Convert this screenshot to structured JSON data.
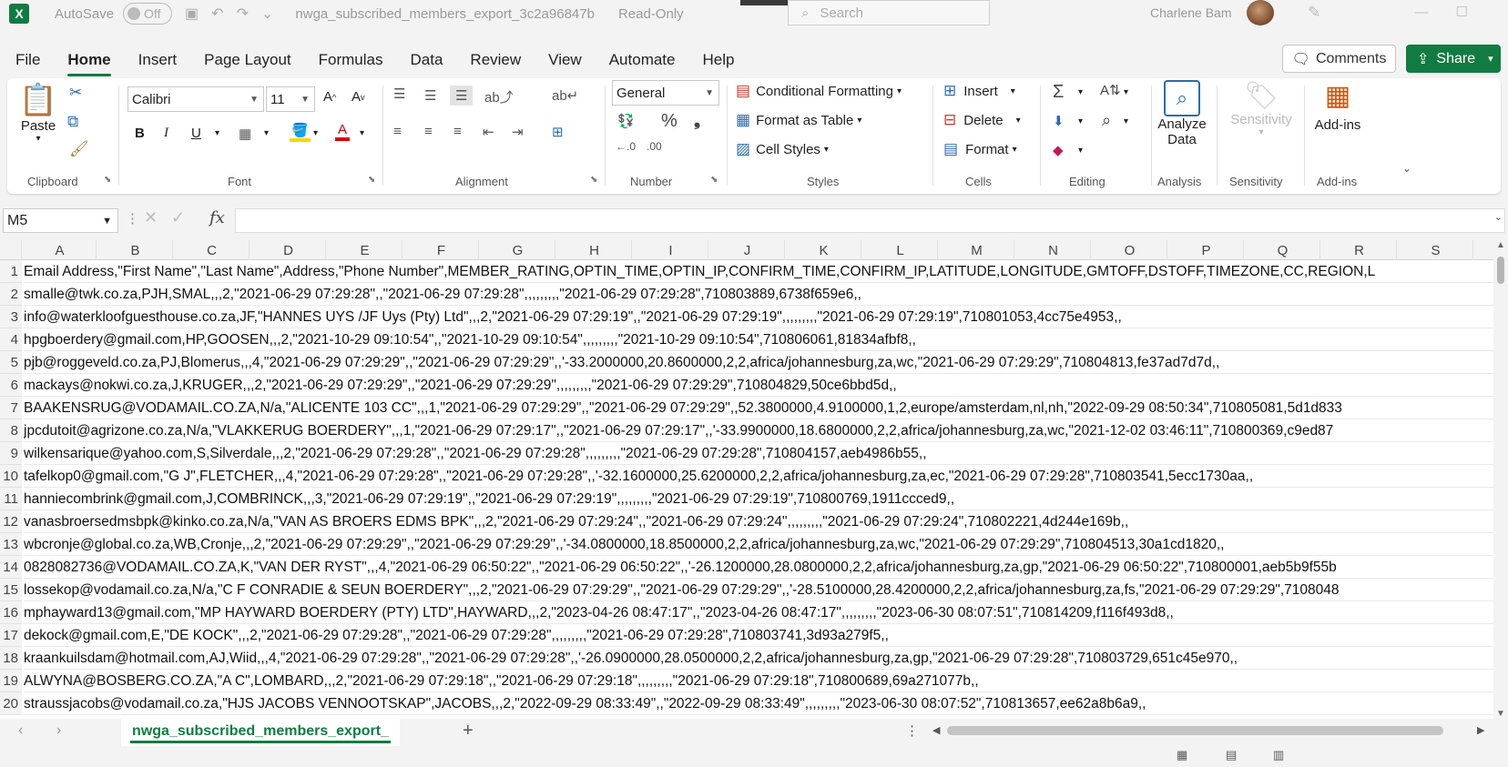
{
  "titlebar": {
    "logo": "X",
    "autosave_label": "AutoSave",
    "autosave_state": "Off",
    "filename": "nwga_subscribed_members_export_3c2a96847b",
    "readonly": "Read-Only",
    "search_placeholder": "Search",
    "user": "Charlene Bam"
  },
  "menu": {
    "tabs": [
      "File",
      "Home",
      "Insert",
      "Page Layout",
      "Formulas",
      "Data",
      "Review",
      "View",
      "Automate",
      "Help"
    ],
    "comments": "Comments",
    "share": "Share"
  },
  "ribbon": {
    "paste": "Paste",
    "font_name": "Calibri",
    "font_size": "11",
    "number_format": "General",
    "conditional_formatting": "Conditional Formatting",
    "format_as_table": "Format as Table",
    "cell_styles": "Cell Styles",
    "insert": "Insert",
    "delete": "Delete",
    "format": "Format",
    "analyze_data_1": "Analyze",
    "analyze_data_2": "Data",
    "sensitivity": "Sensitivity",
    "addins": "Add-ins",
    "groups": {
      "clipboard": "Clipboard",
      "font": "Font",
      "alignment": "Alignment",
      "number": "Number",
      "styles": "Styles",
      "cells": "Cells",
      "editing": "Editing",
      "analysis": "Analysis",
      "sensitivity": "Sensitivity",
      "addins": "Add-ins"
    }
  },
  "formula": {
    "namebox": "M5",
    "fx": "fx",
    "value": ""
  },
  "grid": {
    "columns": [
      "A",
      "B",
      "C",
      "D",
      "E",
      "F",
      "G",
      "H",
      "I",
      "J",
      "K",
      "L",
      "M",
      "N",
      "O",
      "P",
      "Q",
      "R",
      "S"
    ],
    "rows": [
      {
        "n": "1",
        "text": "Email Address,\"First Name\",\"Last Name\",Address,\"Phone Number\",MEMBER_RATING,OPTIN_TIME,OPTIN_IP,CONFIRM_TIME,CONFIRM_IP,LATITUDE,LONGITUDE,GMTOFF,DSTOFF,TIMEZONE,CC,REGION,L"
      },
      {
        "n": "2",
        "text": "smalle@twk.co.za,PJH,SMAL,,,2,\"2021-06-29 07:29:28\",,\"2021-06-29 07:29:28\",,,,,,,,,\"2021-06-29 07:29:28\",710803889,6738f659e6,,"
      },
      {
        "n": "3",
        "text": "info@waterkloofguesthouse.co.za,JF,\"HANNES UYS /JF Uys (Pty) Ltd\",,,2,\"2021-06-29 07:29:19\",,\"2021-06-29 07:29:19\",,,,,,,,,\"2021-06-29 07:29:19\",710801053,4cc75e4953,,"
      },
      {
        "n": "4",
        "text": "hpgboerdery@gmail.com,HP,GOOSEN,,,2,\"2021-10-29 09:10:54\",,\"2021-10-29 09:10:54\",,,,,,,,,\"2021-10-29 09:10:54\",710806061,81834afbf8,,"
      },
      {
        "n": "5",
        "text": "pjb@roggeveld.co.za,PJ,Blomerus,,,4,\"2021-06-29 07:29:29\",,\"2021-06-29 07:29:29\",,'-33.2000000,20.8600000,2,2,africa/johannesburg,za,wc,\"2021-06-29 07:29:29\",710804813,fe37ad7d7d,,"
      },
      {
        "n": "6",
        "text": "mackays@nokwi.co.za,J,KRUGER,,,2,\"2021-06-29 07:29:29\",,\"2021-06-29 07:29:29\",,,,,,,,,\"2021-06-29 07:29:29\",710804829,50ce6bbd5d,,"
      },
      {
        "n": "7",
        "text": "BAAKENSRUG@VODAMAIL.CO.ZA,N/a,\"ALICENTE 103 CC\",,,1,\"2021-06-29 07:29:29\",,\"2021-06-29 07:29:29\",,52.3800000,4.9100000,1,2,europe/amsterdam,nl,nh,\"2022-09-29 08:50:34\",710805081,5d1d833"
      },
      {
        "n": "8",
        "text": "jpcdutoit@agrizone.co.za,N/a,\"VLAKKERUG BOERDERY\",,,1,\"2021-06-29 07:29:17\",,\"2021-06-29 07:29:17\",,'-33.9900000,18.6800000,2,2,africa/johannesburg,za,wc,\"2021-12-02 03:46:11\",710800369,c9ed87"
      },
      {
        "n": "9",
        "text": "wilkensarique@yahoo.com,S,Silverdale,,,2,\"2021-06-29 07:29:28\",,\"2021-06-29 07:29:28\",,,,,,,,,\"2021-06-29 07:29:28\",710804157,aeb4986b55,,"
      },
      {
        "n": "10",
        "text": "tafelkop0@gmail.com,\"G J\",FLETCHER,,,4,\"2021-06-29 07:29:28\",,\"2021-06-29 07:29:28\",,'-32.1600000,25.6200000,2,2,africa/johannesburg,za,ec,\"2021-06-29 07:29:28\",710803541,5ecc1730aa,,"
      },
      {
        "n": "11",
        "text": "hanniecombrink@gmail.com,J,COMBRINCK,,,3,\"2021-06-29 07:29:19\",,\"2021-06-29 07:29:19\",,,,,,,,,\"2021-06-29 07:29:19\",710800769,1911ccced9,,"
      },
      {
        "n": "12",
        "text": "vanasbroersedmsbpk@kinko.co.za,N/a,\"VAN AS BROERS EDMS BPK\",,,2,\"2021-06-29 07:29:24\",,\"2021-06-29 07:29:24\",,,,,,,,,\"2021-06-29 07:29:24\",710802221,4d244e169b,,"
      },
      {
        "n": "13",
        "text": "wbcronje@global.co.za,WB,Cronje,,,2,\"2021-06-29 07:29:29\",,\"2021-06-29 07:29:29\",,'-34.0800000,18.8500000,2,2,africa/johannesburg,za,wc,\"2021-06-29 07:29:29\",710804513,30a1cd1820,,"
      },
      {
        "n": "14",
        "text": "0828082736@VODAMAIL.CO.ZA,K,\"VAN DER RYST\",,,4,\"2021-06-29 06:50:22\",,\"2021-06-29 06:50:22\",,'-26.1200000,28.0800000,2,2,africa/johannesburg,za,gp,\"2021-06-29 06:50:22\",710800001,aeb5b9f55b"
      },
      {
        "n": "15",
        "text": "lossekop@vodamail.co.za,N/a,\"C F CONRADIE & SEUN BOERDERY\",,,2,\"2021-06-29 07:29:29\",,\"2021-06-29 07:29:29\",,'-28.5100000,28.4200000,2,2,africa/johannesburg,za,fs,\"2021-06-29 07:29:29\",7108048"
      },
      {
        "n": "16",
        "text": "mphayward13@gmail.com,\"MP HAYWARD BOERDERY (PTY) LTD\",HAYWARD,,,2,\"2023-04-26 08:47:17\",,\"2023-04-26 08:47:17\",,,,,,,,,\"2023-06-30 08:07:51\",710814209,f116f493d8,,"
      },
      {
        "n": "17",
        "text": "dekock@gmail.com,E,\"DE KOCK\",,,2,\"2021-06-29 07:29:28\",,\"2021-06-29 07:29:28\",,,,,,,,,\"2021-06-29 07:29:28\",710803741,3d93a279f5,,"
      },
      {
        "n": "18",
        "text": "kraankuilsdam@hotmail.com,AJ,Wiid,,,4,\"2021-06-29 07:29:28\",,\"2021-06-29 07:29:28\",,'-26.0900000,28.0500000,2,2,africa/johannesburg,za,gp,\"2021-06-29 07:29:28\",710803729,651c45e970,,"
      },
      {
        "n": "19",
        "text": "ALWYNA@BOSBERG.CO.ZA,\"A C\",LOMBARD,,,2,\"2021-06-29 07:29:18\",,\"2021-06-29 07:29:18\",,,,,,,,,\"2021-06-29 07:29:18\",710800689,69a271077b,,"
      },
      {
        "n": "20",
        "text": "straussjacobs@vodamail.co.za,\"HJS JACOBS VENNOOTSKAP\",JACOBS,,,2,\"2022-09-29 08:33:49\",,\"2022-09-29 08:33:49\",,,,,,,,,\"2023-06-30 08:07:52\",710813657,ee62a8b6a9,,"
      }
    ]
  },
  "sheet": {
    "tab_name": "nwga_subscribed_members_export_",
    "add": "+"
  }
}
